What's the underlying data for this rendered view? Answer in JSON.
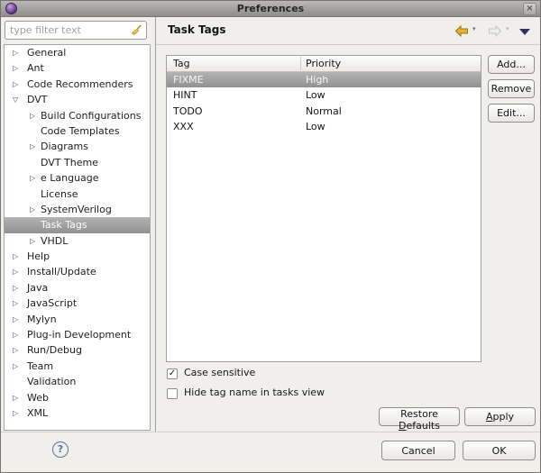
{
  "window": {
    "title": "Preferences"
  },
  "glyphs": {
    "close": "×",
    "check": "✓",
    "tree_collapsed": "▷",
    "tree_expanded": "▽",
    "nav_chevron": "▾",
    "help": "?"
  },
  "filter": {
    "placeholder": "type filter text"
  },
  "tree": {
    "items": [
      {
        "label": "General",
        "state": "collapsed",
        "level": 0,
        "selected": false
      },
      {
        "label": "Ant",
        "state": "collapsed",
        "level": 0,
        "selected": false
      },
      {
        "label": "Code Recommenders",
        "state": "collapsed",
        "level": 0,
        "selected": false
      },
      {
        "label": "DVT",
        "state": "expanded",
        "level": 0,
        "selected": false
      },
      {
        "label": "Build Configurations",
        "state": "collapsed",
        "level": 1,
        "selected": false
      },
      {
        "label": "Code Templates",
        "state": "leaf",
        "level": 1,
        "selected": false
      },
      {
        "label": "Diagrams",
        "state": "collapsed",
        "level": 1,
        "selected": false
      },
      {
        "label": "DVT Theme",
        "state": "leaf",
        "level": 1,
        "selected": false
      },
      {
        "label": "e Language",
        "state": "collapsed",
        "level": 1,
        "selected": false
      },
      {
        "label": "License",
        "state": "leaf",
        "level": 1,
        "selected": false
      },
      {
        "label": "SystemVerilog",
        "state": "collapsed",
        "level": 1,
        "selected": false
      },
      {
        "label": "Task Tags",
        "state": "leaf",
        "level": 1,
        "selected": true
      },
      {
        "label": "VHDL",
        "state": "collapsed",
        "level": 1,
        "selected": false
      },
      {
        "label": "Help",
        "state": "collapsed",
        "level": 0,
        "selected": false
      },
      {
        "label": "Install/Update",
        "state": "collapsed",
        "level": 0,
        "selected": false
      },
      {
        "label": "Java",
        "state": "collapsed",
        "level": 0,
        "selected": false
      },
      {
        "label": "JavaScript",
        "state": "collapsed",
        "level": 0,
        "selected": false
      },
      {
        "label": "Mylyn",
        "state": "collapsed",
        "level": 0,
        "selected": false
      },
      {
        "label": "Plug-in Development",
        "state": "collapsed",
        "level": 0,
        "selected": false
      },
      {
        "label": "Run/Debug",
        "state": "collapsed",
        "level": 0,
        "selected": false
      },
      {
        "label": "Team",
        "state": "collapsed",
        "level": 0,
        "selected": false
      },
      {
        "label": "Validation",
        "state": "leaf",
        "level": 0,
        "selected": false
      },
      {
        "label": "Web",
        "state": "collapsed",
        "level": 0,
        "selected": false
      },
      {
        "label": "XML",
        "state": "collapsed",
        "level": 0,
        "selected": false
      }
    ]
  },
  "page": {
    "title": "Task Tags",
    "table": {
      "columns": [
        "Tag",
        "Priority"
      ],
      "rows": [
        {
          "tag": "FIXME",
          "priority": "High",
          "selected": true
        },
        {
          "tag": "HINT",
          "priority": "Low",
          "selected": false
        },
        {
          "tag": "TODO",
          "priority": "Normal",
          "selected": false
        },
        {
          "tag": "XXX",
          "priority": "Low",
          "selected": false
        }
      ]
    },
    "side_buttons": {
      "add": "Add...",
      "remove": "Remove",
      "edit": "Edit..."
    },
    "checkboxes": [
      {
        "label": "Case sensitive",
        "checked": true
      },
      {
        "label": "Hide tag name in tasks view",
        "checked": false
      }
    ],
    "actions": {
      "restore": {
        "label": "Restore Defaults",
        "mnemonic": "D"
      },
      "apply": {
        "label": "Apply",
        "mnemonic": "A"
      }
    }
  },
  "footer": {
    "cancel": "Cancel",
    "ok": "OK"
  },
  "colors": {
    "selection_top": "#b3b3b3",
    "selection_bottom": "#919191",
    "back_arrow": "#e5b13a",
    "menu_triangle": "#32325e",
    "help_icon": "#56729e",
    "window_icon": "#7a4ba0"
  }
}
